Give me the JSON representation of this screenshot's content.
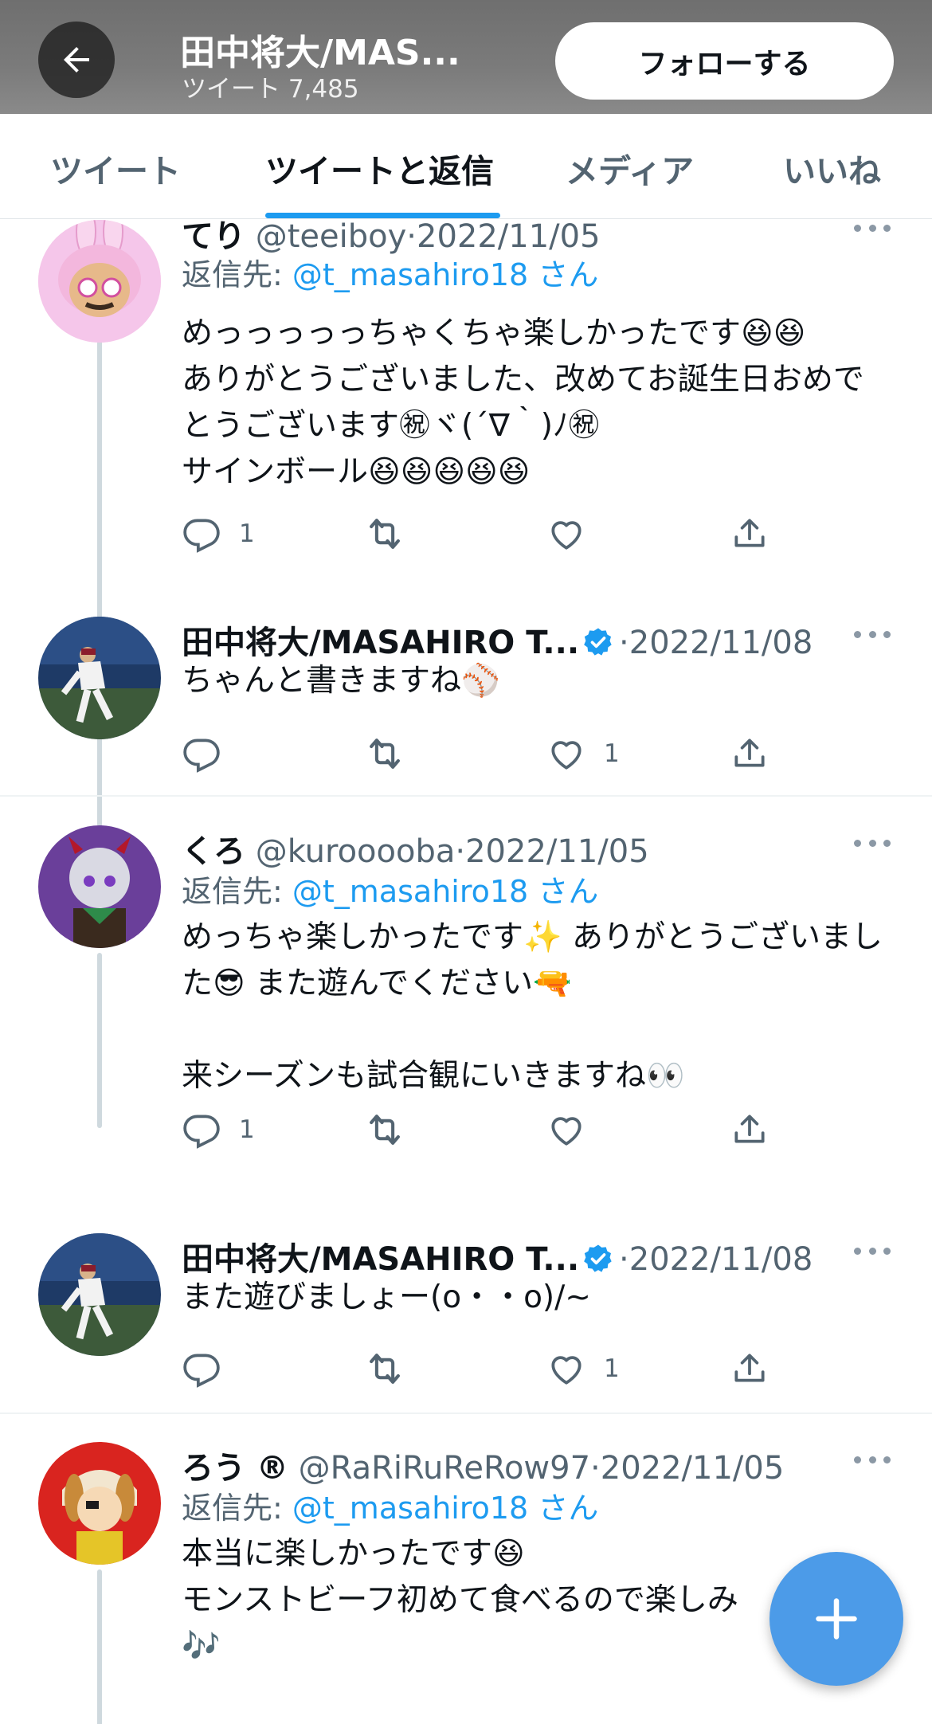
{
  "header": {
    "title": "田中将大/MAS...",
    "subtitle": "ツイート 7,485",
    "follow_label": "フォローする"
  },
  "tabs": [
    {
      "label": "ツイート",
      "active": false
    },
    {
      "label": "ツイートと返信",
      "active": true
    },
    {
      "label": "メディア",
      "active": false
    },
    {
      "label": "いいね",
      "active": false
    }
  ],
  "tweets": [
    {
      "name": "てり",
      "handle": "@teeiboy",
      "date": "2022/11/05",
      "reply_prefix": "返信先:",
      "reply_handle": "@t_masahiro18",
      "reply_suffix": "さん",
      "text": "めっっっっっちゃくちゃ楽しかったです😆😆\nありがとうございました、改めてお誕生日おめでとうございます㊗ヾ(´∇｀)ﾉ㊗\nサインボール😆😆😆😆😆",
      "reply_count": "1",
      "like_count": ""
    },
    {
      "name": "田中将大/MASAHIRO T...",
      "date": "2022/11/08",
      "text": "ちゃんと書きますね⚾",
      "reply_count": "",
      "like_count": "1"
    },
    {
      "name": "くろ",
      "handle": "@kurooooba",
      "date": "2022/11/05",
      "reply_prefix": "返信先:",
      "reply_handle": "@t_masahiro18",
      "reply_suffix": "さん",
      "text": "めっちゃ楽しかったです✨ ありがとうございました😎 また遊んでください🔫\n\n来シーズンも試合観にいきますね👀",
      "reply_count": "1",
      "like_count": ""
    },
    {
      "name": "田中将大/MASAHIRO T...",
      "date": "2022/11/08",
      "text": "また遊びましょー(o・・o)/~",
      "reply_count": "",
      "like_count": "1"
    },
    {
      "name": "ろう ®",
      "handle": "@RaRiRuReRow97",
      "date": "2022/11/05",
      "reply_prefix": "返信先:",
      "reply_handle": "@t_masahiro18",
      "reply_suffix": "さん",
      "text": "本当に楽しかったです😆\nモンストビーフ初めて食べるので楽しみ\n🎶"
    }
  ],
  "colors": {
    "accent": "#1d9bf0",
    "fab": "#4c9be8",
    "text_secondary": "#536471"
  }
}
